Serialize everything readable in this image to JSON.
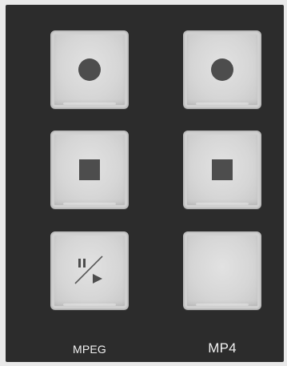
{
  "columns": [
    {
      "label": "MPEG",
      "buttons": [
        {
          "name": "mpeg-record-button",
          "icon": "record-icon"
        },
        {
          "name": "mpeg-stop-button",
          "icon": "stop-icon"
        },
        {
          "name": "mpeg-pause-play-button",
          "icon": "pause-play-icon"
        }
      ]
    },
    {
      "label": "MP4",
      "buttons": [
        {
          "name": "mp4-record-button",
          "icon": "record-icon"
        },
        {
          "name": "mp4-stop-button",
          "icon": "stop-icon"
        },
        {
          "name": "mp4-blank-button",
          "icon": ""
        }
      ]
    }
  ],
  "colors": {
    "panel": "#2c2c2c",
    "button_face": "#d6d6d6",
    "icon": "#4d4d4d",
    "label_text": "#f2f2f2"
  }
}
